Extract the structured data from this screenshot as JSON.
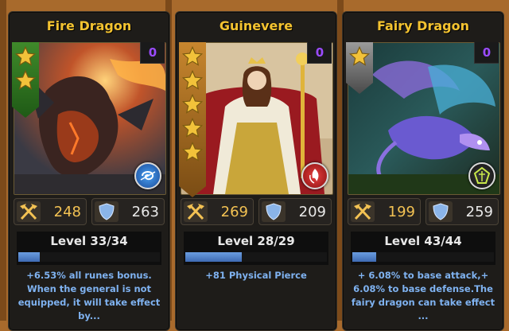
{
  "colors": {
    "background": "#a86a2c",
    "card": "#1e1c19",
    "name": "#f4c330",
    "attack": "#f3c253",
    "description": "#7fb2f0",
    "count": "#9a4bff"
  },
  "cards": [
    {
      "name": "Fire Dragon",
      "count": "0",
      "stars": 2,
      "ribbon_color": "green",
      "type_icon": "spiral-wave-icon",
      "attack": "248",
      "defense": "263",
      "level": "Level 33/34",
      "level_progress": 0.15,
      "description": "+6.53% all runes bonus. When the general is not equipped, it will take effect by..."
    },
    {
      "name": "Guinevere",
      "count": "0",
      "stars": 5,
      "ribbon_color": "gold",
      "type_icon": "flame-emblem-icon",
      "attack": "269",
      "defense": "209",
      "level": "Level 28/29",
      "level_progress": 0.4,
      "description": "+81 Physical Pierce"
    },
    {
      "name": "Fairy Dragon",
      "count": "0",
      "stars": 1,
      "ribbon_color": "silver",
      "type_icon": "leaf-emblem-icon",
      "attack": "199",
      "defense": "259",
      "level": "Level 43/44",
      "level_progress": 0.17,
      "description": "+ 6.08% to base attack,+ 6.08% to base defense.The fairy dragon can take effect ..."
    }
  ]
}
